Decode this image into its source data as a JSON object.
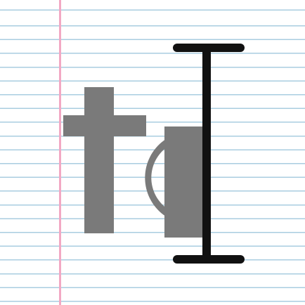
{
  "paper": {
    "background_color": "#ffffff",
    "rule_color": "#a9cde0",
    "margin_color": "#f2a9c4"
  },
  "letters": {
    "text": "te",
    "color": "#7a7a7a",
    "cut_at_cursor": true
  },
  "cursor": {
    "icon": "text-cursor-i-beam-icon",
    "color": "#111111"
  }
}
